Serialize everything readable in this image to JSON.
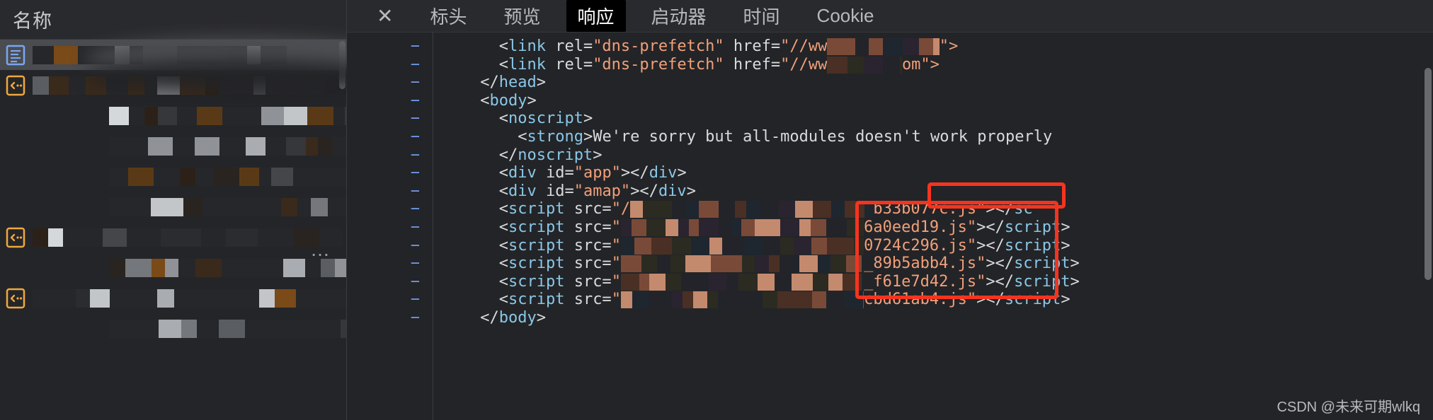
{
  "sidebar": {
    "header_label": "名称",
    "ellipsis_label": "…",
    "items": [
      {
        "icon": "document-icon",
        "redacted": true,
        "selected": true,
        "indent": 1
      },
      {
        "icon": "js-code-icon",
        "redacted": true,
        "selected": false,
        "indent": 1
      },
      {
        "icon": "none",
        "redacted": true,
        "selected": false,
        "indent": 2
      },
      {
        "icon": "none",
        "redacted": true,
        "selected": false,
        "indent": 2
      },
      {
        "icon": "none",
        "redacted": true,
        "selected": false,
        "indent": 3
      },
      {
        "icon": "none",
        "redacted": true,
        "selected": false,
        "indent": 3
      },
      {
        "icon": "js-code-icon",
        "redacted": true,
        "selected": false,
        "indent": 1
      },
      {
        "icon": "none",
        "redacted": true,
        "selected": false,
        "indent": 2
      },
      {
        "icon": "js-code-icon",
        "redacted": true,
        "selected": false,
        "indent": 1
      },
      {
        "icon": "none",
        "redacted": true,
        "selected": false,
        "indent": 2
      }
    ]
  },
  "tabbar": {
    "close_label": "✕",
    "tabs": [
      {
        "label": "标头",
        "active": false
      },
      {
        "label": "预览",
        "active": false
      },
      {
        "label": "响应",
        "active": true
      },
      {
        "label": "启动器",
        "active": false
      },
      {
        "label": "时间",
        "active": false
      },
      {
        "label": "Cookie",
        "active": false
      }
    ]
  },
  "code": {
    "fold_marker": "−",
    "lines": [
      {
        "indent": 7,
        "segments": [
          {
            "t": "punc",
            "v": "<"
          },
          {
            "t": "tag",
            "v": "link"
          },
          {
            "t": "txt",
            "v": " rel="
          },
          {
            "t": "attr",
            "v": "\"dns-prefetch\""
          },
          {
            "t": "txt",
            "v": " href="
          },
          {
            "t": "attr",
            "v": "\"//ww"
          },
          {
            "t": "redact",
            "v": "            "
          },
          {
            "t": "attr",
            "v": "\">"
          }
        ]
      },
      {
        "indent": 7,
        "segments": [
          {
            "t": "punc",
            "v": "<"
          },
          {
            "t": "tag",
            "v": "link"
          },
          {
            "t": "txt",
            "v": " rel="
          },
          {
            "t": "attr",
            "v": "\"dns-prefetch\""
          },
          {
            "t": "txt",
            "v": " href="
          },
          {
            "t": "attr",
            "v": "\"//ww"
          },
          {
            "t": "redact",
            "v": "        "
          },
          {
            "t": "attr",
            "v": "om\">"
          }
        ]
      },
      {
        "indent": 5,
        "segments": [
          {
            "t": "punc",
            "v": "</"
          },
          {
            "t": "tag",
            "v": "head"
          },
          {
            "t": "punc",
            "v": ">"
          }
        ]
      },
      {
        "indent": 5,
        "segments": [
          {
            "t": "punc",
            "v": "<"
          },
          {
            "t": "tag",
            "v": "body"
          },
          {
            "t": "punc",
            "v": ">"
          }
        ]
      },
      {
        "indent": 7,
        "segments": [
          {
            "t": "punc",
            "v": "<"
          },
          {
            "t": "tag",
            "v": "noscript"
          },
          {
            "t": "punc",
            "v": ">"
          }
        ]
      },
      {
        "indent": 9,
        "segments": [
          {
            "t": "punc",
            "v": "<"
          },
          {
            "t": "tag",
            "v": "strong"
          },
          {
            "t": "punc",
            "v": ">"
          },
          {
            "t": "txt",
            "v": "We're sorry but all-modules doesn't work properly"
          }
        ]
      },
      {
        "indent": 7,
        "segments": [
          {
            "t": "punc",
            "v": "</"
          },
          {
            "t": "tag",
            "v": "noscript"
          },
          {
            "t": "punc",
            "v": ">"
          }
        ]
      },
      {
        "indent": 7,
        "segments": [
          {
            "t": "punc",
            "v": "<"
          },
          {
            "t": "tag",
            "v": "div"
          },
          {
            "t": "txt",
            "v": " id="
          },
          {
            "t": "attr",
            "v": "\"app\""
          },
          {
            "t": "punc",
            "v": "></"
          },
          {
            "t": "tag",
            "v": "div"
          },
          {
            "t": "punc",
            "v": ">"
          }
        ]
      },
      {
        "indent": 7,
        "segments": [
          {
            "t": "punc",
            "v": "<"
          },
          {
            "t": "tag",
            "v": "div"
          },
          {
            "t": "txt",
            "v": " id="
          },
          {
            "t": "attr",
            "v": "\"amap\""
          },
          {
            "t": "punc",
            "v": "></"
          },
          {
            "t": "tag",
            "v": "div"
          },
          {
            "t": "punc",
            "v": ">"
          }
        ]
      },
      {
        "indent": 7,
        "segments": [
          {
            "t": "punc",
            "v": "<"
          },
          {
            "t": "tag",
            "v": "script"
          },
          {
            "t": "txt",
            "v": " src="
          },
          {
            "t": "attr",
            "v": "\"/"
          },
          {
            "t": "redact",
            "v": "                          "
          },
          {
            "t": "attr",
            "v": "b33b077c.js\""
          },
          {
            "t": "punc",
            "v": "></"
          },
          {
            "t": "tag",
            "v": "sc"
          }
        ]
      },
      {
        "indent": 7,
        "segments": [
          {
            "t": "punc",
            "v": "<"
          },
          {
            "t": "tag",
            "v": "script"
          },
          {
            "t": "txt",
            "v": " src="
          },
          {
            "t": "attr",
            "v": "\""
          },
          {
            "t": "redact",
            "v": "                          "
          },
          {
            "t": "attr",
            "v": "6a0eed19.js\""
          },
          {
            "t": "punc",
            "v": "></"
          },
          {
            "t": "tag",
            "v": "script"
          },
          {
            "t": "punc",
            "v": ">"
          }
        ]
      },
      {
        "indent": 7,
        "segments": [
          {
            "t": "punc",
            "v": "<"
          },
          {
            "t": "tag",
            "v": "script"
          },
          {
            "t": "txt",
            "v": " src="
          },
          {
            "t": "attr",
            "v": "\""
          },
          {
            "t": "redact",
            "v": "                          "
          },
          {
            "t": "attr",
            "v": "0724c296.js\""
          },
          {
            "t": "punc",
            "v": "></"
          },
          {
            "t": "tag",
            "v": "script"
          },
          {
            "t": "punc",
            "v": ">"
          }
        ]
      },
      {
        "indent": 7,
        "segments": [
          {
            "t": "punc",
            "v": "<"
          },
          {
            "t": "tag",
            "v": "script"
          },
          {
            "t": "txt",
            "v": " src="
          },
          {
            "t": "attr",
            "v": "\""
          },
          {
            "t": "redact",
            "v": "                          "
          },
          {
            "t": "attr",
            "v": "_89b5abb4.js\""
          },
          {
            "t": "punc",
            "v": "></"
          },
          {
            "t": "tag",
            "v": "script"
          },
          {
            "t": "punc",
            "v": ">"
          }
        ]
      },
      {
        "indent": 7,
        "segments": [
          {
            "t": "punc",
            "v": "<"
          },
          {
            "t": "tag",
            "v": "script"
          },
          {
            "t": "txt",
            "v": " src="
          },
          {
            "t": "attr",
            "v": "\""
          },
          {
            "t": "redact",
            "v": "                          "
          },
          {
            "t": "attr",
            "v": "_f61e7d42.js\""
          },
          {
            "t": "punc",
            "v": "></"
          },
          {
            "t": "tag",
            "v": "script"
          },
          {
            "t": "punc",
            "v": ">"
          }
        ]
      },
      {
        "indent": 7,
        "segments": [
          {
            "t": "punc",
            "v": "<"
          },
          {
            "t": "tag",
            "v": "script"
          },
          {
            "t": "txt",
            "v": " src="
          },
          {
            "t": "attr",
            "v": "\""
          },
          {
            "t": "redact",
            "v": "                          "
          },
          {
            "t": "attr",
            "v": "cbd61ab4.js\""
          },
          {
            "t": "punc",
            "v": "></"
          },
          {
            "t": "tag",
            "v": "script"
          },
          {
            "t": "punc",
            "v": ">"
          }
        ]
      },
      {
        "indent": 5,
        "segments": [
          {
            "t": "punc",
            "v": "</"
          },
          {
            "t": "tag",
            "v": "body"
          },
          {
            "t": "punc",
            "v": ">"
          }
        ]
      }
    ]
  },
  "annotations": {
    "highlight_color": "#f5341f",
    "boxes": [
      {
        "name": "annotation-box-top",
        "label": "b33b077c.js\""
      },
      {
        "name": "annotation-box-main",
        "label": "6a0eed19.js\" 0724c296.js\" _89b5abb4.js\" _f61e7d42.js\" cbd61ab4.js\""
      }
    ]
  },
  "watermark": {
    "text": "CSDN @未来可期wlkq"
  },
  "colors": {
    "tag": "#8ac7e8",
    "attribute": "#f0a07a",
    "text": "#d8dadc",
    "gutter": "#6f9ae8",
    "background": "#232427",
    "panel": "#292a2d",
    "accent_red": "#f5341f"
  }
}
